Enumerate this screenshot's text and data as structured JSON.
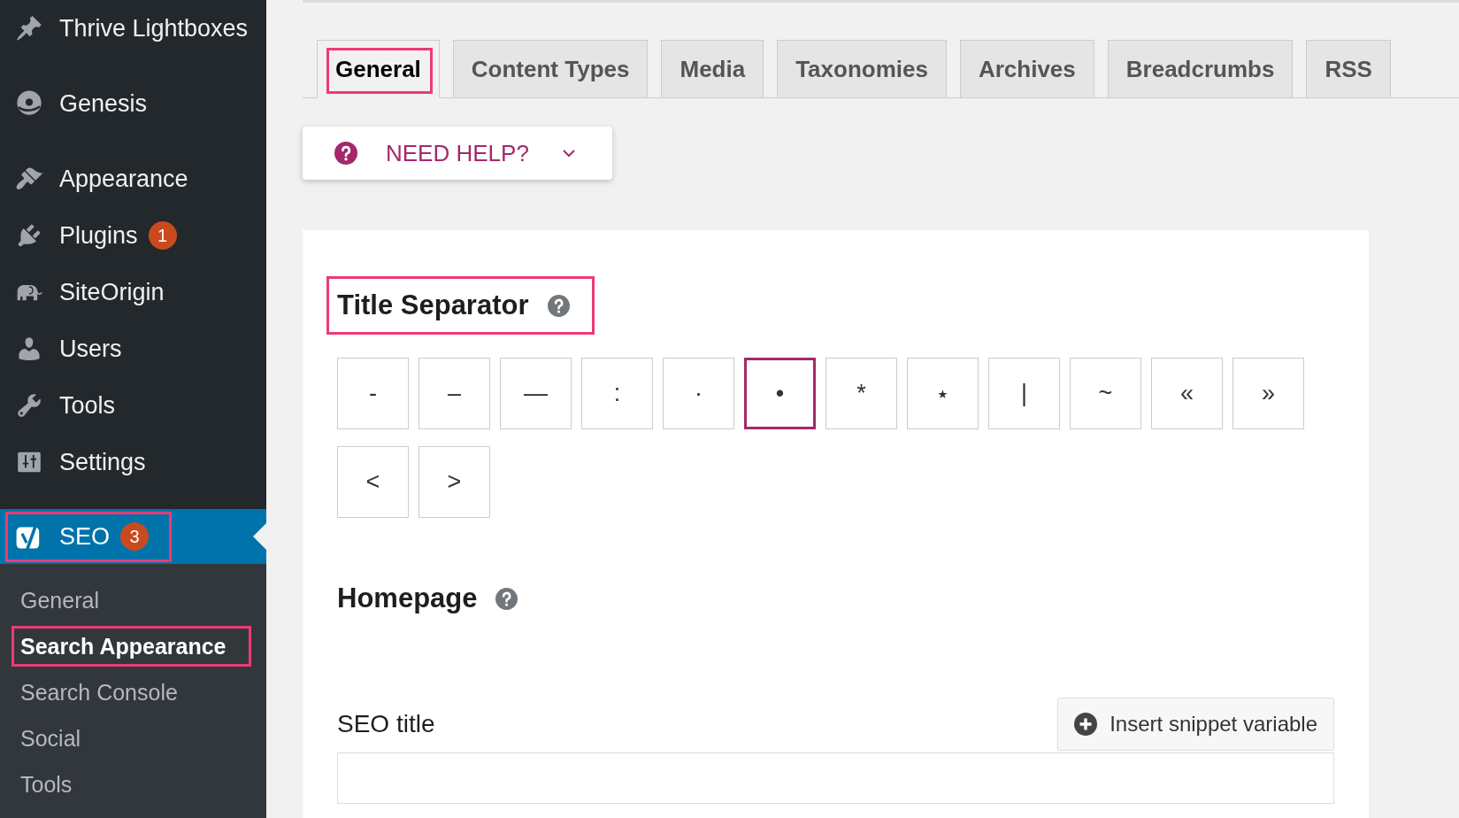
{
  "sidebar": {
    "groups": [
      {
        "items": [
          {
            "label": "Thrive Lightboxes",
            "selected": false,
            "highlighted": false
          }
        ]
      },
      {
        "items": [
          {
            "label": "Genesis",
            "selected": false,
            "highlighted": false
          }
        ]
      },
      {
        "items": [
          {
            "label": "Appearance",
            "selected": false,
            "highlighted": false
          },
          {
            "label": "Plugins",
            "badge": "1",
            "selected": false,
            "highlighted": false
          },
          {
            "label": "SiteOrigin",
            "selected": false,
            "highlighted": false
          },
          {
            "label": "Users",
            "selected": false,
            "highlighted": false
          },
          {
            "label": "Tools",
            "selected": false,
            "highlighted": false
          },
          {
            "label": "Settings",
            "selected": false,
            "highlighted": false
          }
        ]
      },
      {
        "items": [
          {
            "label": "SEO",
            "badge": "3",
            "selected": true,
            "highlighted": true,
            "submenu": [
              {
                "label": "General",
                "selected": false,
                "highlighted": false
              },
              {
                "label": "Search Appearance",
                "selected": true,
                "highlighted": true
              },
              {
                "label": "Search Console",
                "selected": false,
                "highlighted": false
              },
              {
                "label": "Social",
                "selected": false,
                "highlighted": false
              },
              {
                "label": "Tools",
                "selected": false,
                "highlighted": false
              }
            ]
          }
        ]
      }
    ]
  },
  "tabs": [
    {
      "label": "General",
      "selected": true,
      "highlighted": true
    },
    {
      "label": "Content Types",
      "selected": false,
      "highlighted": false
    },
    {
      "label": "Media",
      "selected": false,
      "highlighted": false
    },
    {
      "label": "Taxonomies",
      "selected": false,
      "highlighted": false
    },
    {
      "label": "Archives",
      "selected": false,
      "highlighted": false
    },
    {
      "label": "Breadcrumbs",
      "selected": false,
      "highlighted": false
    },
    {
      "label": "RSS",
      "selected": false,
      "highlighted": false
    }
  ],
  "help_button": {
    "label": "NEED HELP?"
  },
  "sections": [
    {
      "title": "Title Separator",
      "highlighted": true,
      "separators": [
        {
          "symbol": "-",
          "selected": false
        },
        {
          "symbol": "–",
          "selected": false
        },
        {
          "symbol": "—",
          "selected": false
        },
        {
          "symbol": ":",
          "selected": false
        },
        {
          "symbol": "·",
          "selected": false
        },
        {
          "symbol": "•",
          "selected": true
        },
        {
          "symbol": "*",
          "selected": false
        },
        {
          "symbol": "⋆",
          "selected": false
        },
        {
          "symbol": "|",
          "selected": false
        },
        {
          "symbol": "~",
          "selected": false
        },
        {
          "symbol": "«",
          "selected": false
        },
        {
          "symbol": "»",
          "selected": false
        },
        {
          "symbol": "<",
          "selected": false
        },
        {
          "symbol": ">",
          "selected": false
        }
      ]
    },
    {
      "title": "Homepage",
      "highlighted": false,
      "fields": [
        {
          "label": "SEO title",
          "button": "Insert snippet variable"
        }
      ]
    }
  ]
}
